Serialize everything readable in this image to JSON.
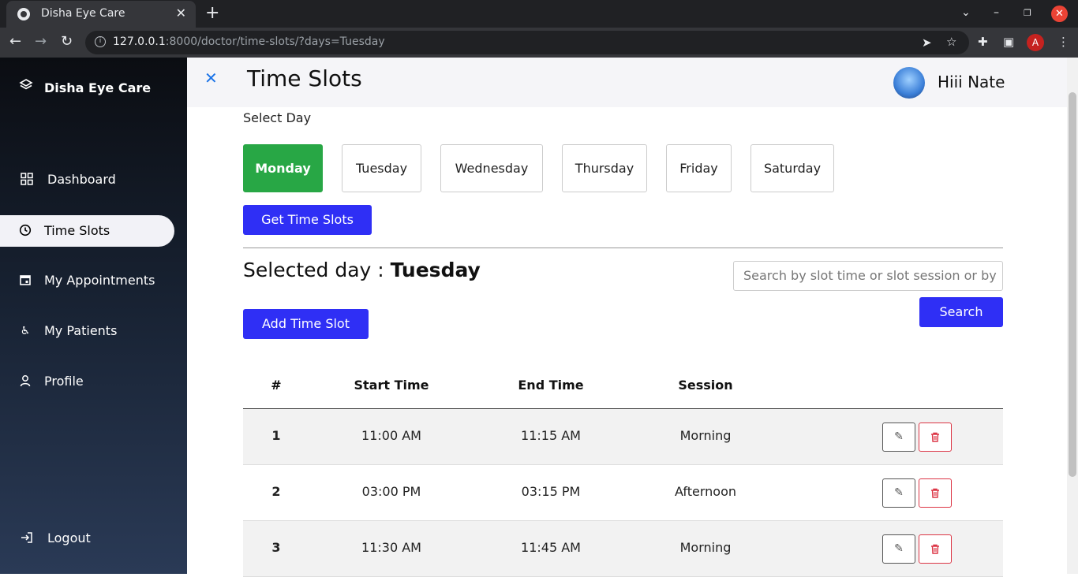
{
  "browser": {
    "tab_title": "Disha Eye Care",
    "url_host": "127.0.0.1",
    "url_rest": ":8000/doctor/time-slots/?days=Tuesday",
    "profile_initial": "A"
  },
  "sidebar": {
    "brand": "Disha Eye Care",
    "items": [
      {
        "label": "Dashboard",
        "icon": "grid-icon"
      },
      {
        "label": "Time Slots",
        "icon": "clock-icon",
        "active": true
      },
      {
        "label": "My Appointments",
        "icon": "calendar-icon"
      },
      {
        "label": "My Patients",
        "icon": "accessibility-icon"
      },
      {
        "label": "Profile",
        "icon": "user-icon"
      }
    ],
    "logout": "Logout"
  },
  "header": {
    "title": "Time Slots",
    "greeting": "Hiii Nate"
  },
  "day_selector": {
    "label": "Select Day",
    "days": [
      "Monday",
      "Tuesday",
      "Wednesday",
      "Thursday",
      "Friday",
      "Saturday"
    ],
    "selected": "Monday",
    "get_button": "Get Time Slots"
  },
  "selected_day": {
    "prefix": "Selected day : ",
    "value": "Tuesday"
  },
  "search": {
    "placeholder": "Search by slot time or slot session or by",
    "button": "Search"
  },
  "add_button": "Add Time Slot",
  "table": {
    "columns": [
      "#",
      "Start Time",
      "End Time",
      "Session"
    ],
    "rows": [
      {
        "num": "1",
        "start": "11:00 AM",
        "end": "11:15 AM",
        "session": "Morning"
      },
      {
        "num": "2",
        "start": "03:00 PM",
        "end": "03:15 PM",
        "session": "Afternoon"
      },
      {
        "num": "3",
        "start": "11:30 AM",
        "end": "11:45 AM",
        "session": "Morning"
      }
    ]
  },
  "colors": {
    "primary": "#2f2ff5",
    "selected_day": "#28a745",
    "danger": "#dc3545"
  }
}
